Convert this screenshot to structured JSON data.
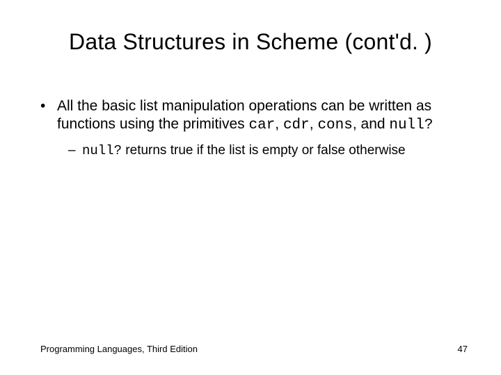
{
  "title": "Data Structures in Scheme (cont'd. )",
  "bullets": {
    "l1": {
      "pre": "All the basic list manipulation operations can be written as functions using the primitives ",
      "code1": "car",
      "sep1": ", ",
      "code2": "cdr",
      "sep2": ", ",
      "code3": "cons",
      "sep3": ", and ",
      "code4": "null?"
    },
    "l2": {
      "code": "null?",
      "post": " returns true if the list is empty or false otherwise"
    }
  },
  "footer": {
    "left": "Programming Languages, Third Edition",
    "right": "47"
  },
  "markers": {
    "l1": "•",
    "l2": "–"
  }
}
